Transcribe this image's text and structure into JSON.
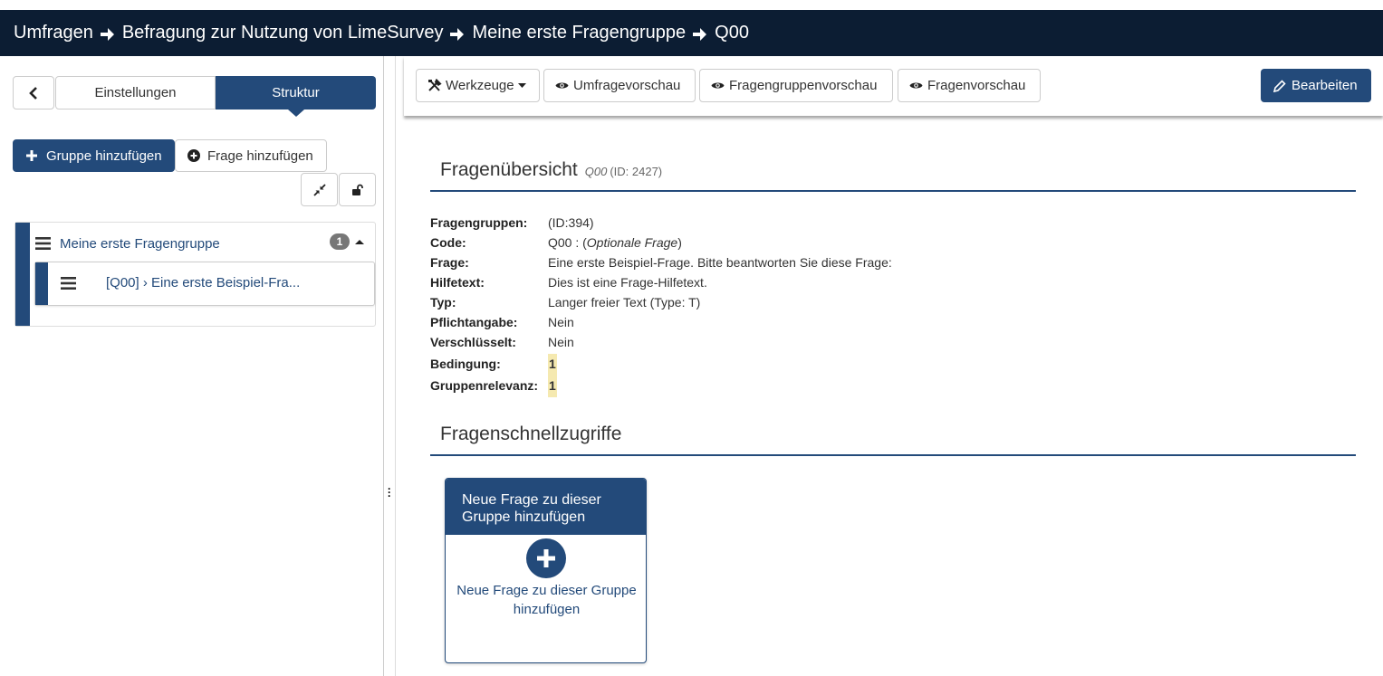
{
  "breadcrumb": {
    "items": [
      "Umfragen",
      "Befragung zur Nutzung von LimeSurvey",
      "Meine erste Fragengruppe",
      "Q00"
    ]
  },
  "sidebar": {
    "tab_settings": "Einstellungen",
    "tab_structure": "Struktur",
    "add_group": "Gruppe hinzufügen",
    "add_question": "Frage hinzufügen",
    "group": {
      "label": "Meine erste Fragengruppe",
      "count": "1",
      "question": "[Q00] › Eine erste Beispiel-Fra..."
    }
  },
  "toolbar": {
    "tools": "Werkzeuge",
    "survey_preview": "Umfragevorschau",
    "group_preview": "Fragengruppenvorschau",
    "question_preview": "Fragenvorschau",
    "edit": "Bearbeiten"
  },
  "overview": {
    "title": "Fragenübersicht",
    "code": "Q00",
    "id_text": "(ID: 2427)",
    "fields": [
      {
        "key": "Fragengruppen:",
        "value": "(ID:394)"
      },
      {
        "key": "Code:",
        "value_prefix": "Q00 : (",
        "value_italic": "Optionale Frage",
        "value_suffix": ")"
      },
      {
        "key": "Frage:",
        "value": "Eine erste Beispiel-Frage. Bitte beantworten Sie diese Frage:"
      },
      {
        "key": "Hilfetext:",
        "value": "Dies ist eine Frage-Hilfetext."
      },
      {
        "key": "Typ:",
        "value": "Langer freier Text (Type: T)"
      },
      {
        "key": "Pflichtangabe:",
        "value": "Nein"
      },
      {
        "key": "Verschlüsselt:",
        "value": "Nein"
      },
      {
        "key": "Bedingung:",
        "value": "1"
      },
      {
        "key": "Gruppenrelevanz:",
        "value": "1"
      }
    ]
  },
  "quick": {
    "title": "Fragenschnellzugriffe",
    "card_head": "Neue Frage zu dieser Gruppe hinzufügen",
    "card_text": "Neue Frage zu dieser Gruppe hinzufügen"
  },
  "colors": {
    "brand": "#234a7a",
    "header_bg": "#0c1d33",
    "highlight": "#f5e9b0"
  }
}
